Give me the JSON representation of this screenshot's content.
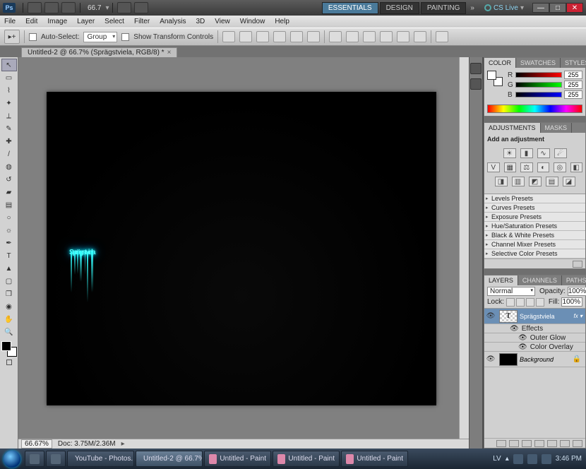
{
  "app_bar": {
    "logo": "Ps",
    "zoom_display": "66.7",
    "workspaces": {
      "essentials": "ESSENTIALS",
      "design": "DESIGN",
      "painting": "PAINTING"
    },
    "cs_live": "CS Live"
  },
  "menu": {
    "file": "File",
    "edit": "Edit",
    "image": "Image",
    "layer": "Layer",
    "select": "Select",
    "filter": "Filter",
    "analysis": "Analysis",
    "threeD": "3D",
    "view": "View",
    "window": "Window",
    "help": "Help"
  },
  "options": {
    "auto_select": "Auto-Select:",
    "group": "Group",
    "show_transform": "Show Transform Controls"
  },
  "document": {
    "tab_title": "Untitled-2 @ 66.7% (Sprägstviela, RGB/8) *",
    "canvas_text": "Sprägstviela",
    "status_zoom": "66.67%",
    "status_doc": "Doc: 3.75M/2.36M"
  },
  "color_panel": {
    "tabs": {
      "color": "COLOR",
      "swatches": "SWATCHES",
      "styles": "STYLES"
    },
    "r_label": "R",
    "g_label": "G",
    "b_label": "B",
    "r_val": "255",
    "g_val": "255",
    "b_val": "255"
  },
  "adjustments_panel": {
    "tabs": {
      "adjustments": "ADJUSTMENTS",
      "masks": "MASKS"
    },
    "header": "Add an adjustment",
    "presets": {
      "levels": "Levels Presets",
      "curves": "Curves Presets",
      "exposure": "Exposure Presets",
      "hue": "Hue/Saturation Presets",
      "bw": "Black & White Presets",
      "mixer": "Channel Mixer Presets",
      "selective": "Selective Color Presets"
    }
  },
  "layers_panel": {
    "tabs": {
      "layers": "LAYERS",
      "channels": "CHANNELS",
      "paths": "PATHS"
    },
    "blend_mode": "Normal",
    "opacity_label": "Opacity:",
    "opacity_val": "100%",
    "lock_label": "Lock:",
    "fill_label": "Fill:",
    "fill_val": "100%",
    "layer_text": "Sprägstviela",
    "effects": "Effects",
    "effect_outer_glow": "Outer Glow",
    "effect_color_overlay": "Color Overlay",
    "background": "Background"
  },
  "taskbar": {
    "items": {
      "youtube": "YouTube - Photos...",
      "ps": "Untitled-2 @ 66.7%...",
      "paint1": "Untitled - Paint",
      "paint2": "Untitled - Paint",
      "paint3": "Untitled - Paint"
    },
    "lang": "LV",
    "time": "3:46 PM"
  }
}
